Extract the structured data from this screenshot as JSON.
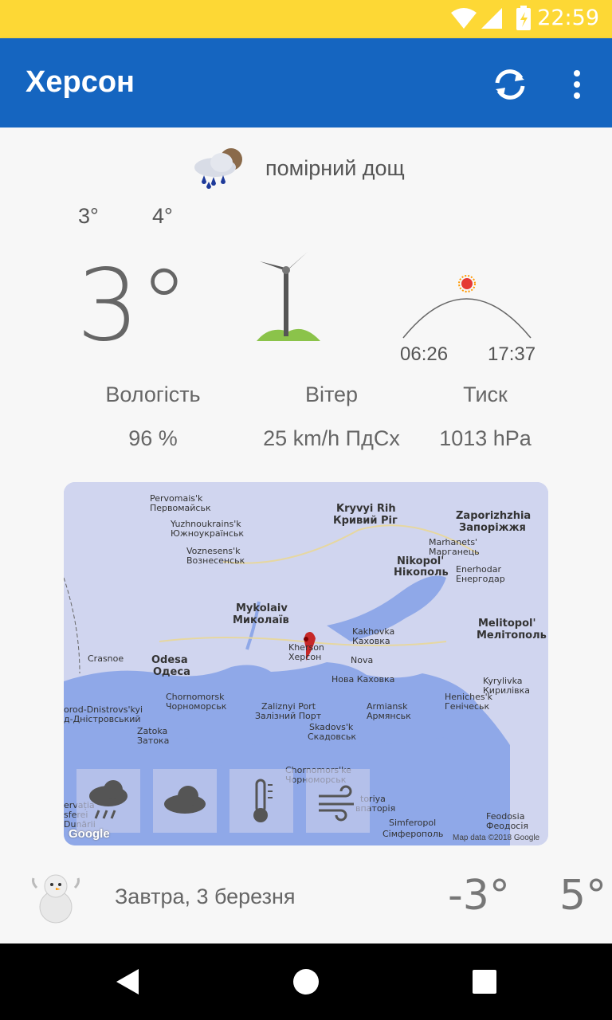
{
  "status_bar": {
    "time": "22:59"
  },
  "app_bar": {
    "title": "Херсон"
  },
  "current": {
    "condition": "помірний дощ",
    "temp_low": "3°",
    "temp_high": "4°",
    "temp": "3°",
    "sunrise": "06:26",
    "sunset": "17:37",
    "metrics": [
      {
        "label": "Вологість",
        "value": "96 %"
      },
      {
        "label": "Вітер",
        "value": "25 km/h ПдСх"
      },
      {
        "label": "Тиск",
        "value": "1013 hPa"
      }
    ]
  },
  "map": {
    "labels": {
      "pervomaisk": "Pervomais'k",
      "pervomaisk_ua": "Первомайськ",
      "yuzhno": "Yuzhnoukrains'k",
      "yuzhno_ua": "Южноукраїнськ",
      "voznesensk": "Voznesens'k",
      "voznesensk_ua": "Вознесенськ",
      "kryvyi": "Kryvyi Rih",
      "kryvyi_ua": "Кривий Ріг",
      "zaporizhzhia": "Zaporizhzhia",
      "zaporizhzhia_ua": "Запоріжжя",
      "marhanets": "Marhanets'",
      "marhanets_ua": "Марганець",
      "nikopol": "Nikopol'",
      "nikopol_ua": "Нікополь",
      "enerhodar": "Enerhodar",
      "enerhodar_ua": "Енергодар",
      "mykolaiv": "Mykolaiv",
      "mykolaiv_ua": "Миколаїв",
      "kakhovka": "Kakhovka",
      "kakhovka_ua": "Каховка",
      "melitopol": "Melitopol'",
      "melitopol_ua": "Мелітополь",
      "krasnoe": "Crasnoe",
      "odesa": "Odesa",
      "odesa_ua": "Одеса",
      "kherson": "Kherson",
      "kherson_ua": "Херсон",
      "nova": "Nova",
      "nova_ua": "Нова Каховка",
      "kyrylivka": "Kyrylivka",
      "kyrylivka_ua": "Кирилівка",
      "chornomorsk": "Chornomorsk",
      "chornomorsk_ua": "Чорноморськ",
      "bilhorod": "orod-Dnistrovs'kyi",
      "bilhorod_ua": "д-Дністровський",
      "zaliznyi": "Zaliznyi Port",
      "zaliznyi_ua": "Залізний Порт",
      "armiansk": "Armiansk",
      "armiansk_ua": "Армянськ",
      "henichesk": "Heniches'k",
      "henichesk_ua": "Генічеськ",
      "zatoka": "Zatoka",
      "zatoka_ua": "Затока",
      "skadovsk": "Skadovs'k",
      "skadovsk_ua": "Скадовськ",
      "chornomorske": "Chornomors'ke",
      "chornomorske_ua": "Чорноморськ",
      "evpatoriya": "toriya",
      "evpatoriya_ua": "впаторія",
      "feodosia": "Feodosia",
      "feodosia_ua": "Феодосія",
      "simferopol": "Simferopol",
      "simferopol_ua": "Сімферополь",
      "ervatia": "ervația",
      "sferei": "sferei",
      "dunarii": "Dunării"
    },
    "google": "Google",
    "attribution": "Map data ©2018 Google",
    "layer_buttons": [
      "rain-layer",
      "cloud-layer",
      "temperature-layer",
      "wind-layer"
    ]
  },
  "tomorrow": {
    "label": "Завтра, 3 березня",
    "temp_min": "-3°",
    "temp_max": "5°"
  },
  "colors": {
    "status_bar": "#fdd835",
    "app_bar": "#1565c0",
    "background": "#f7f7f7"
  }
}
